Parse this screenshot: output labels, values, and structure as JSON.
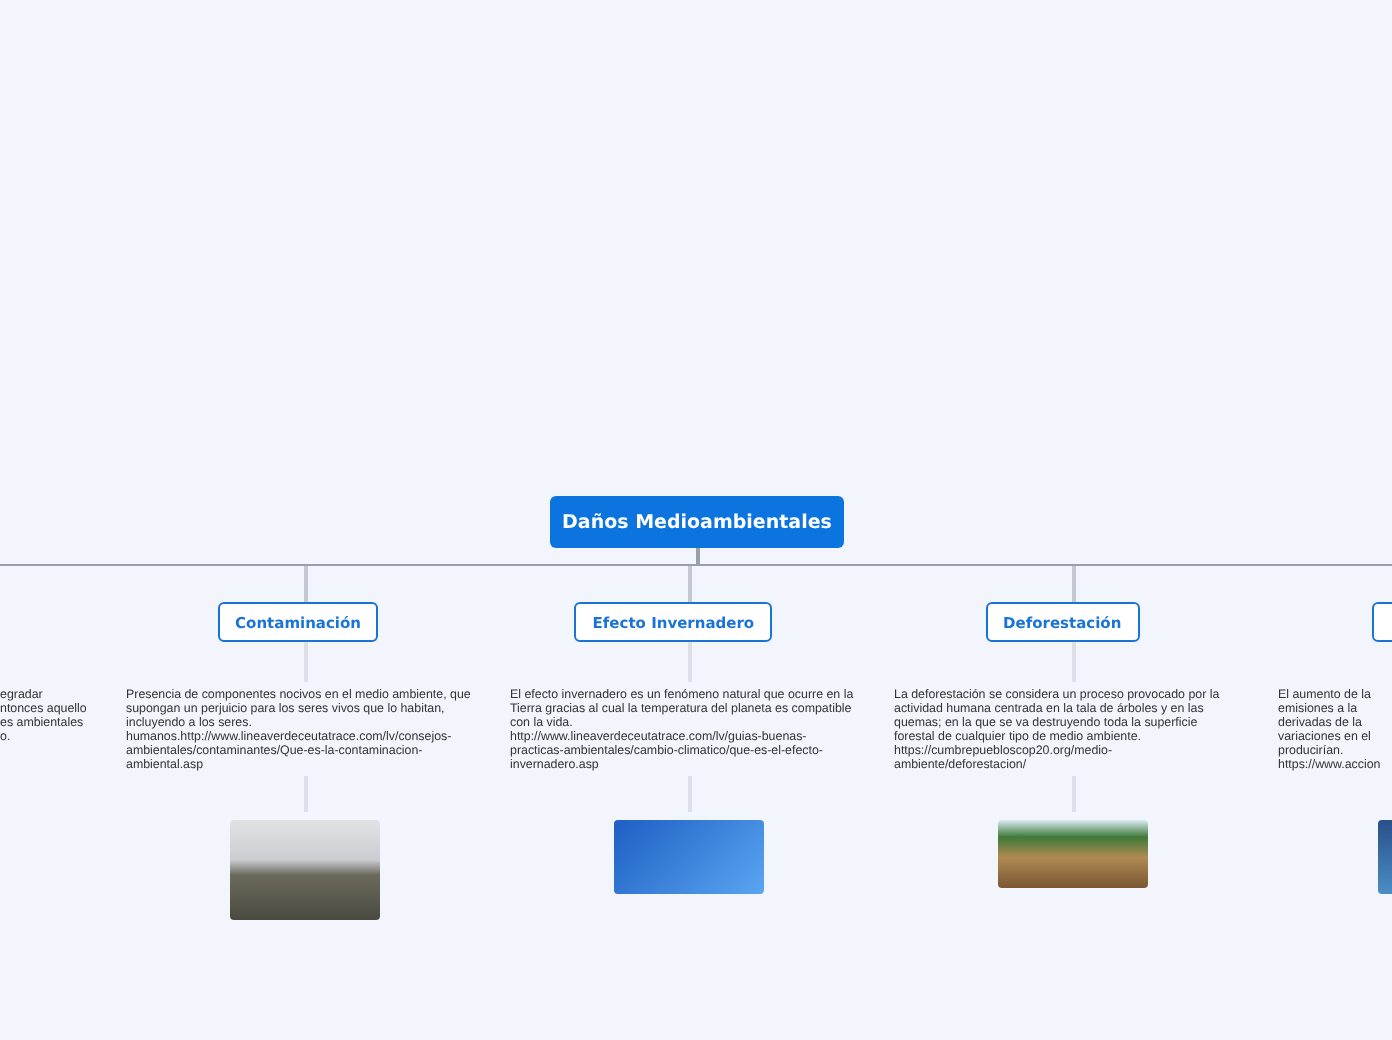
{
  "root": {
    "title": "Daños Medioambientales"
  },
  "branches": [
    {
      "lines": [
        "egradar",
        "ntonces aquello",
        "es ambientales",
        "o."
      ],
      "image": false
    },
    {
      "title": "Contaminación",
      "lines": [
        "Presencia de componentes nocivos en el medio ambiente, que",
        "supongan un perjuicio para los seres vivos que lo habitan,",
        "incluyendo a los seres.",
        "humanos.http://www.lineaverdeceutatrace.com/lv/consejos-",
        "ambientales/contaminantes/Que-es-la-contaminacion-",
        "ambiental.asp"
      ],
      "image": true
    },
    {
      "title": "Efecto Invernadero",
      "lines": [
        "El efecto invernadero es un fenómeno natural que ocurre en la",
        "Tierra gracias al cual la temperatura del planeta es compatible",
        "con la vida.",
        "http://www.lineaverdeceutatrace.com/lv/guias-buenas-",
        "practicas-ambientales/cambio-climatico/que-es-el-efecto-",
        "invernadero.asp"
      ],
      "image": true
    },
    {
      "title": "Deforestación",
      "lines": [
        "La deforestación se considera un proceso provocado por la",
        "actividad humana centrada en la tala de árboles y en las",
        "quemas; en la que se va destruyendo toda la superficie",
        "forestal de cualquier tipo de medio ambiente.",
        "https://cumbrepuebloscop20.org/medio-",
        "ambiente/deforestacion/"
      ],
      "image": true
    },
    {
      "lines": [
        "El aumento de la",
        "emisiones a la",
        "derivadas de la",
        "variaciones en el",
        "producirían.",
        "https://www.accion"
      ],
      "image": true
    }
  ]
}
